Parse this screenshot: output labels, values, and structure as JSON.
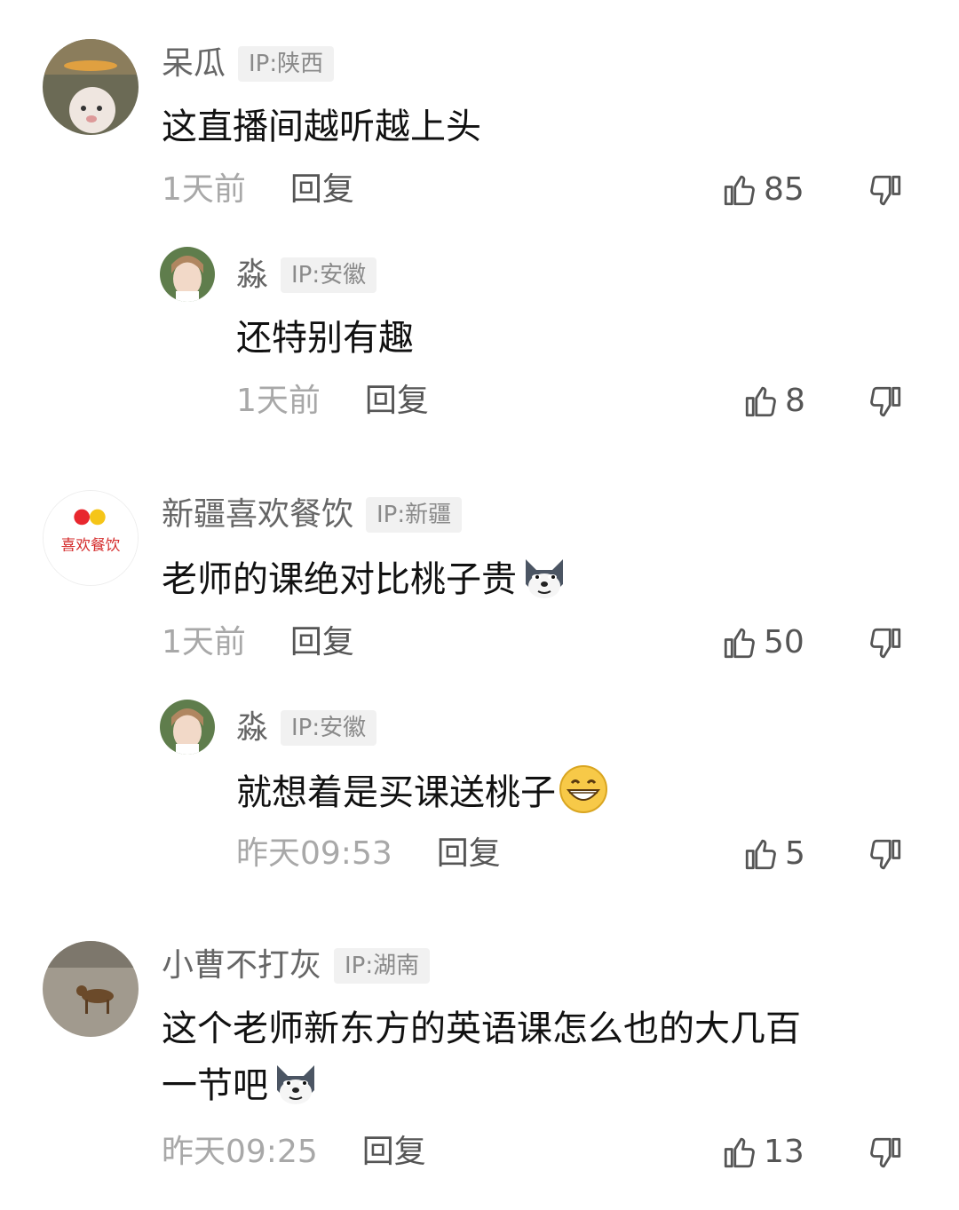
{
  "comments": [
    {
      "user": "呆瓜",
      "ip": "IP:陕西",
      "text": "这直播间越听越上头",
      "time": "1天前",
      "reply": "回复",
      "likes": "85"
    },
    {
      "user": "淼",
      "ip": "IP:安徽",
      "text": "还特别有趣",
      "time": "1天前",
      "reply": "回复",
      "likes": "8"
    },
    {
      "user": "新疆喜欢餐饮",
      "ip": "IP:新疆",
      "text": "老师的课绝对比桃子贵",
      "time": "1天前",
      "reply": "回复",
      "likes": "50",
      "avatar_text": "喜欢餐饮"
    },
    {
      "user": "淼",
      "ip": "IP:安徽",
      "text": "就想着是买课送桃子",
      "time": "昨天09:53",
      "reply": "回复",
      "likes": "5"
    },
    {
      "user": "小曹不打灰",
      "ip": "IP:湖南",
      "text_line1": "这个老师新东方的英语课怎么也的大几百",
      "text_line2": "一节吧",
      "time": "昨天09:25",
      "reply": "回复",
      "likes": "13"
    }
  ],
  "icons": {
    "like": "thumbs-up-icon",
    "dislike": "thumbs-down-icon",
    "emoji_dog": "doge-emoji",
    "emoji_grin": "grin-emoji"
  },
  "colors": {
    "username": "#666666",
    "time": "#a8a8a8",
    "text": "#111111",
    "ip_bg": "#f1f1f1"
  }
}
